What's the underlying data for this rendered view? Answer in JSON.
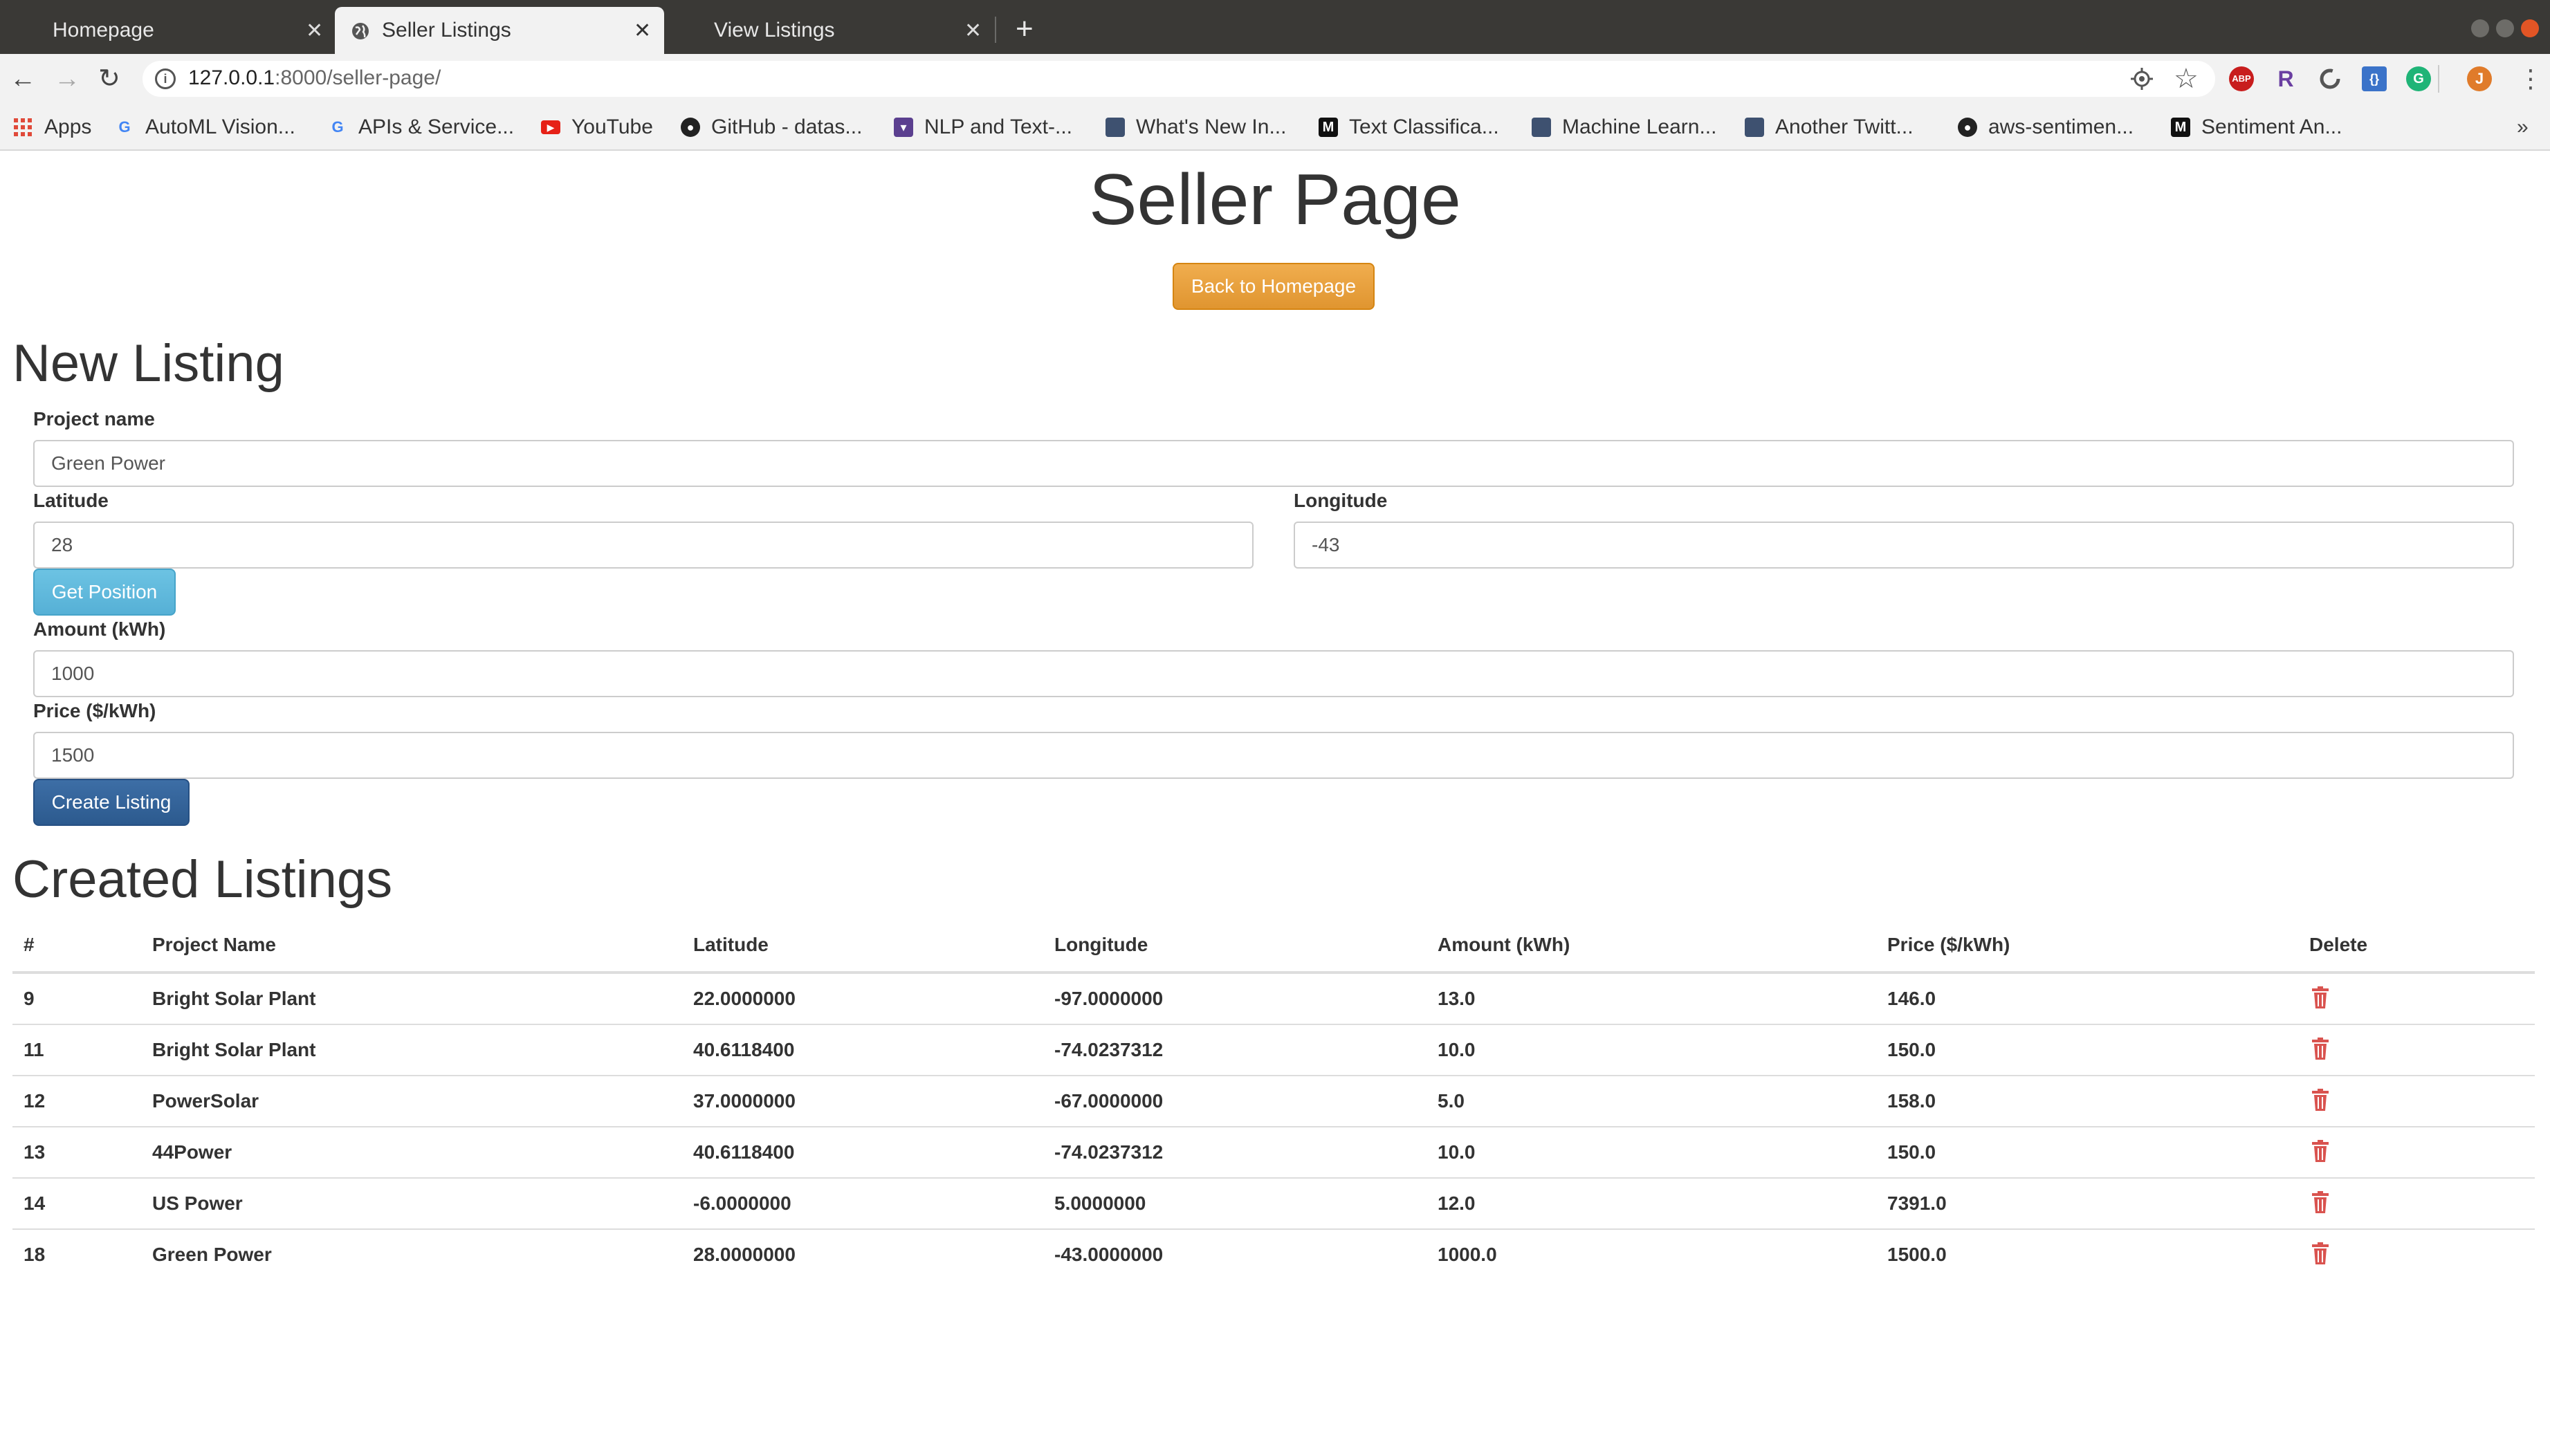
{
  "browser": {
    "tabs": [
      {
        "title": "Homepage",
        "active": false
      },
      {
        "title": "Seller Listings",
        "active": true
      },
      {
        "title": "View Listings",
        "active": false
      }
    ],
    "url_host": "127.0.0.1",
    "url_path": ":8000/seller-page/",
    "profile_initial": "J",
    "bookmarks": [
      {
        "label": "Apps",
        "icon": "apps-grid-icon"
      },
      {
        "label": "AutoML Vision...",
        "icon": "google-icon"
      },
      {
        "label": "APIs & Service...",
        "icon": "google-icon"
      },
      {
        "label": "YouTube",
        "icon": "youtube-icon"
      },
      {
        "label": "GitHub - datas...",
        "icon": "github-icon"
      },
      {
        "label": "NLP and Text-...",
        "icon": "bookmark-icon"
      },
      {
        "label": "What's New In...",
        "icon": "page-icon"
      },
      {
        "label": "Text Classifica...",
        "icon": "medium-icon"
      },
      {
        "label": "Machine Learn...",
        "icon": "page-icon"
      },
      {
        "label": "Another Twitt...",
        "icon": "page-icon"
      },
      {
        "label": "aws-sentimen...",
        "icon": "github-icon"
      },
      {
        "label": "Sentiment An...",
        "icon": "medium-icon"
      }
    ]
  },
  "page": {
    "title": "Seller Page",
    "back_button": "Back to Homepage"
  },
  "new_listing": {
    "heading": "New Listing",
    "project_name_label": "Project name",
    "project_name_value": "Green Power",
    "latitude_label": "Latitude",
    "latitude_value": "28",
    "longitude_label": "Longitude",
    "longitude_value": "-43",
    "get_position_button": "Get Position",
    "amount_label": "Amount (kWh)",
    "amount_value": "1000",
    "price_label": "Price ($/kWh)",
    "price_value": "1500",
    "create_button": "Create Listing"
  },
  "created_listings": {
    "heading": "Created Listings",
    "columns": [
      "#",
      "Project Name",
      "Latitude",
      "Longitude",
      "Amount (kWh)",
      "Price ($/kWh)",
      "Delete"
    ],
    "rows": [
      {
        "id": "9",
        "name": "Bright Solar Plant",
        "lat": "22.0000000",
        "lon": "-97.0000000",
        "amount": "13.0",
        "price": "146.0"
      },
      {
        "id": "11",
        "name": "Bright Solar Plant",
        "lat": "40.6118400",
        "lon": "-74.0237312",
        "amount": "10.0",
        "price": "150.0"
      },
      {
        "id": "12",
        "name": "PowerSolar",
        "lat": "37.0000000",
        "lon": "-67.0000000",
        "amount": "5.0",
        "price": "158.0"
      },
      {
        "id": "13",
        "name": "44Power",
        "lat": "40.6118400",
        "lon": "-74.0237312",
        "amount": "10.0",
        "price": "150.0"
      },
      {
        "id": "14",
        "name": "US Power",
        "lat": "-6.0000000",
        "lon": "5.0000000",
        "amount": "12.0",
        "price": "7391.0"
      },
      {
        "id": "18",
        "name": "Green Power",
        "lat": "28.0000000",
        "lon": "-43.0000000",
        "amount": "1000.0",
        "price": "1500.0"
      }
    ]
  },
  "colors": {
    "warning": "#f0ad4e",
    "info": "#5bc0de",
    "primary": "#337ab7",
    "delete_icon": "#d9534f"
  }
}
